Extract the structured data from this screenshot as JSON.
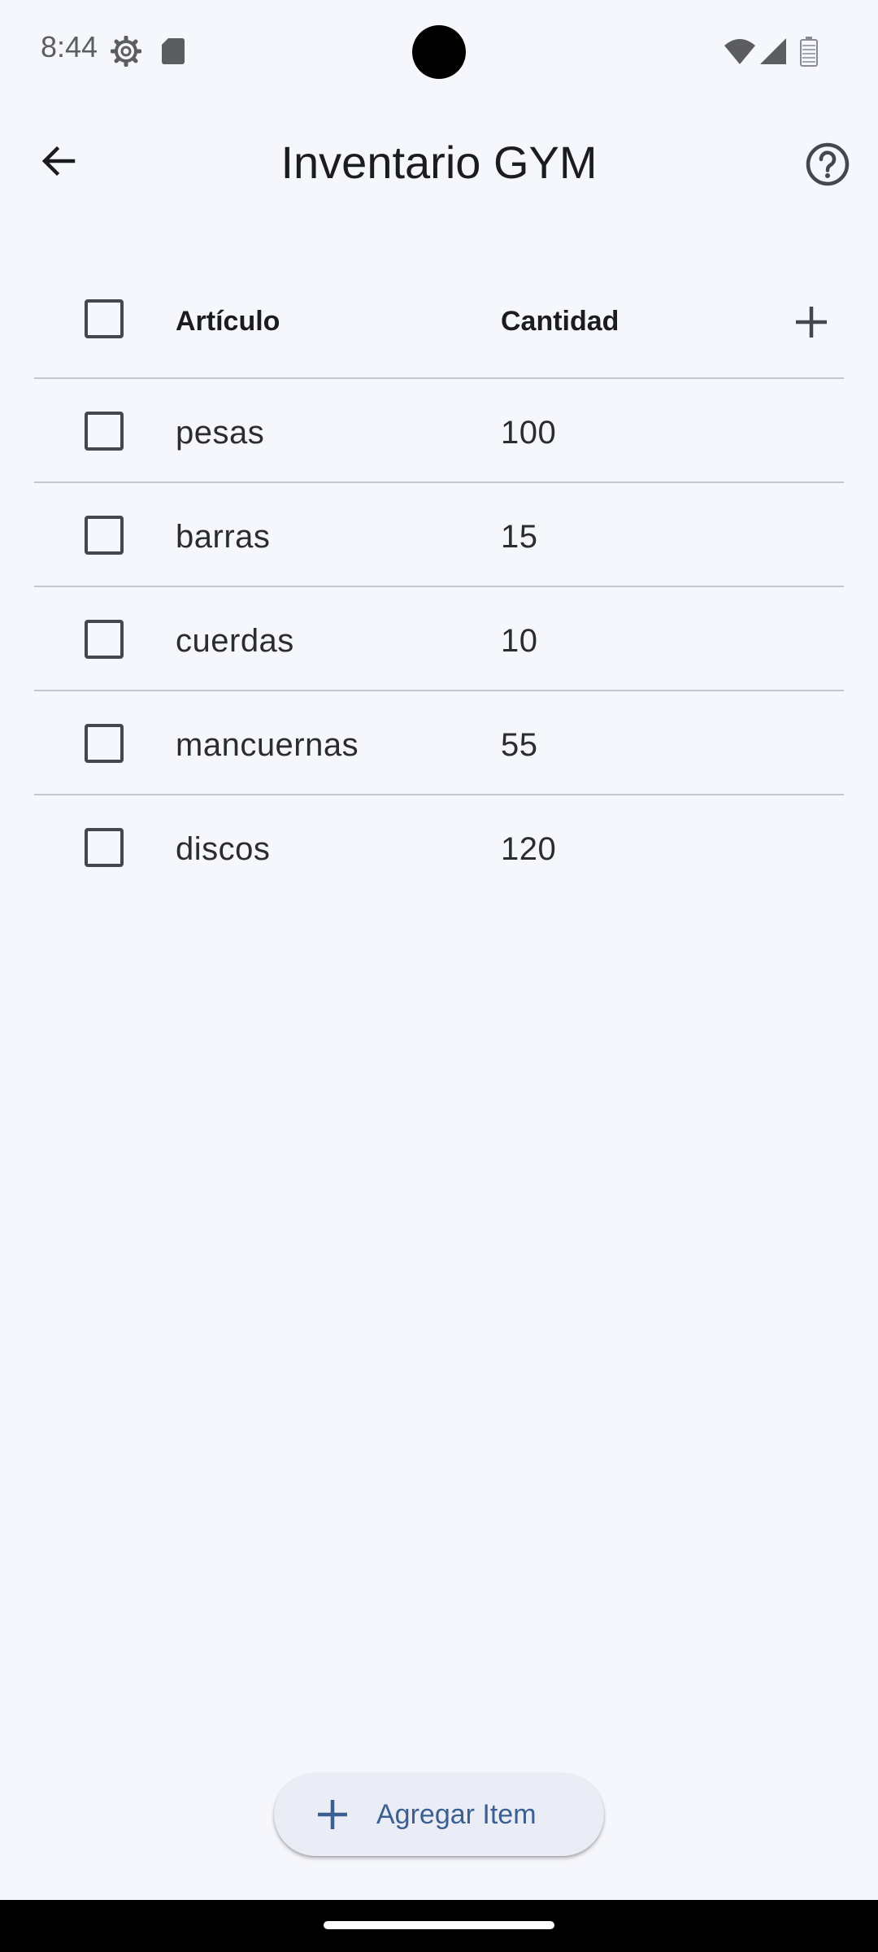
{
  "status_bar": {
    "time": "8:44",
    "icons": [
      "gear-icon",
      "sd-card-icon",
      "wifi-icon",
      "signal-icon",
      "battery-icon"
    ]
  },
  "app_bar": {
    "title": "Inventario GYM",
    "back_icon": "arrow-back-icon",
    "help_icon": "help-circle-icon"
  },
  "table": {
    "columns": [
      "Artículo",
      "Cantidad"
    ],
    "add_column_icon": "plus-icon",
    "rows": [
      {
        "name": "pesas",
        "quantity": "100",
        "checked": false
      },
      {
        "name": "barras",
        "quantity": "15",
        "checked": false
      },
      {
        "name": "cuerdas",
        "quantity": "10",
        "checked": false
      },
      {
        "name": "mancuernas",
        "quantity": "55",
        "checked": false
      },
      {
        "name": "discos",
        "quantity": "120",
        "checked": false
      }
    ]
  },
  "fab": {
    "label": "Agregar Item",
    "icon": "plus-icon"
  },
  "colors": {
    "background": "#f6f7fc",
    "accent": "#3a5f90",
    "fab_background": "#ebedf6",
    "divider": "#c4c6cf"
  }
}
